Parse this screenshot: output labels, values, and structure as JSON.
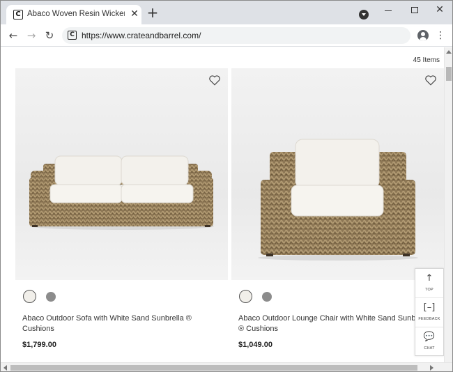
{
  "browser": {
    "tab_title": "Abaco Woven Resin Wicker Outdoor",
    "tab_favicon_letter": "C",
    "tab_close_glyph": "✕",
    "new_tab_glyph": "+",
    "address": "https://www.crateandbarrel.com/",
    "address_icon_letter": "C",
    "back_glyph": "←",
    "forward_glyph": "→",
    "reload_glyph": "↻",
    "menu_glyph": "⋮",
    "close_glyph": "✕",
    "icons": [
      "profile-dropdown-icon",
      "minimize-icon",
      "maximize-icon",
      "account-icon"
    ]
  },
  "page": {
    "items_count": "45 Items",
    "products": [
      {
        "name": "Abaco Outdoor Sofa with White Sand Sunbrella ® Cushions",
        "price": "$1,799.00",
        "swatches": [
          "#f1efea",
          "#8c8c8c"
        ]
      },
      {
        "name": "Abaco Outdoor Lounge Chair with White Sand Sunbrella ® Cushions",
        "price": "$1,049.00",
        "swatches": [
          "#f1efea",
          "#8c8c8c"
        ]
      }
    ]
  },
  "widget": {
    "top_label": "TOP",
    "top_glyph": "↑",
    "feedback_label": "FEEDBACK",
    "feedback_glyph": "[–]",
    "chat_label": "CHAT",
    "chat_glyph": "💬"
  },
  "colors": {
    "tabstrip": "#dee1e6",
    "wicker": "#8b7552",
    "cushion": "#f1efea"
  }
}
